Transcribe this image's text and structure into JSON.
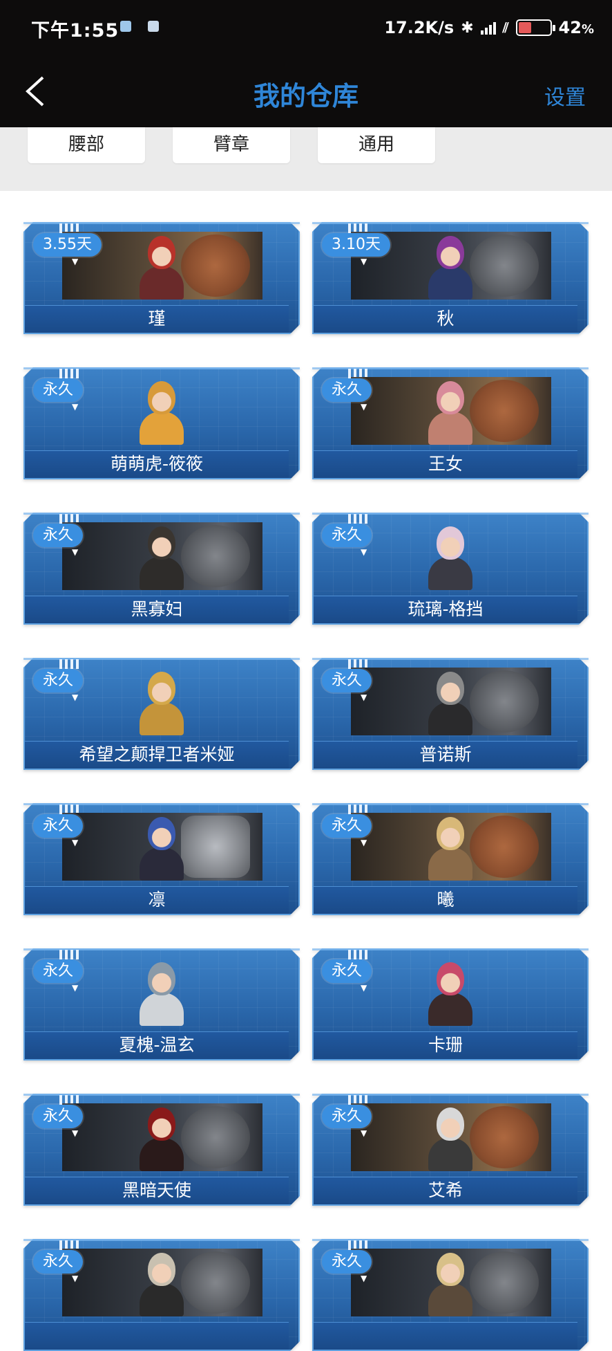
{
  "status_bar": {
    "time": "下午1:55",
    "net_speed": "17.2K/s",
    "battery": "42",
    "battery_unit": "%",
    "battery_level": 0.42
  },
  "nav": {
    "title": "我的仓库",
    "settings_label": "设置"
  },
  "tabs": [
    "腰部",
    "臂章",
    "通用"
  ],
  "items": [
    {
      "name": "瑾",
      "badge": "3.55天",
      "plate": "bronze",
      "hair": "#b8322a",
      "outfit": "#6a2a2a"
    },
    {
      "name": "秋",
      "badge": "3.10天",
      "plate": "dark",
      "hair": "#8a3a9a",
      "outfit": "#2a3a6a"
    },
    {
      "name": "萌萌虎-筱筱",
      "badge": "永久",
      "plate": "none",
      "hair": "#d79a3a",
      "outfit": "#e3a23a"
    },
    {
      "name": "王女",
      "badge": "永久",
      "plate": "bronze",
      "hair": "#d88a9a",
      "outfit": "#c08070"
    },
    {
      "name": "黑寡妇",
      "badge": "永久",
      "plate": "dark",
      "hair": "#3a3530",
      "outfit": "#2e2c2a"
    },
    {
      "name": "琉璃-格挡",
      "badge": "永久",
      "plate": "none",
      "hair": "#e2c8d8",
      "outfit": "#3a3a44"
    },
    {
      "name": "希望之颠捍卫者米娅",
      "badge": "永久",
      "plate": "none",
      "hair": "#d4a84a",
      "outfit": "#c4943a"
    },
    {
      "name": "普诺斯",
      "badge": "永久",
      "plate": "dark",
      "hair": "#8a8a8a",
      "outfit": "#2a2a2c"
    },
    {
      "name": "凛",
      "badge": "永久",
      "plate": "star",
      "hair": "#3a5ab0",
      "outfit": "#2a2a3a"
    },
    {
      "name": "曦",
      "badge": "永久",
      "plate": "bronze",
      "hair": "#d8b878",
      "outfit": "#8a6a48"
    },
    {
      "name": "夏槐-温玄",
      "badge": "永久",
      "plate": "none",
      "hair": "#8a9aa8",
      "outfit": "#d0d4d8"
    },
    {
      "name": "卡珊",
      "badge": "永久",
      "plate": "none",
      "hair": "#c84a6a",
      "outfit": "#3a2a2a"
    },
    {
      "name": "黑暗天使",
      "badge": "永久",
      "plate": "dark",
      "hair": "#8a1a1a",
      "outfit": "#2a1a1a"
    },
    {
      "name": "艾希",
      "badge": "永久",
      "plate": "bronze",
      "hair": "#d8d8d8",
      "outfit": "#3a3a3a"
    },
    {
      "name": "",
      "badge": "永久",
      "plate": "dark",
      "hair": "#c8c0b0",
      "outfit": "#2a2a2a"
    },
    {
      "name": "",
      "badge": "永久",
      "plate": "dark",
      "hair": "#d8c088",
      "outfit": "#5a4a3a"
    }
  ]
}
